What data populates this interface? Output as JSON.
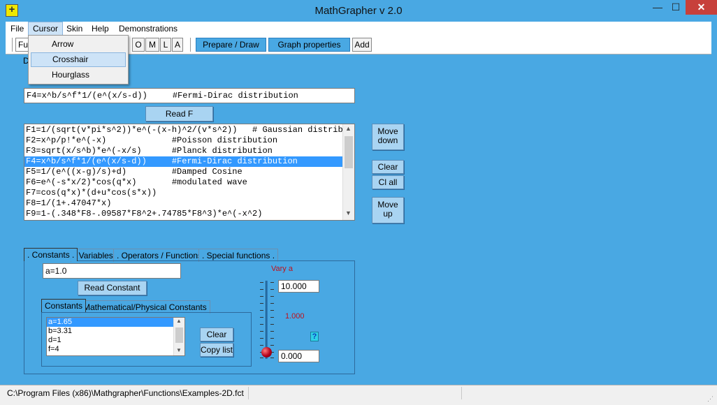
{
  "window": {
    "title": "MathGrapher v 2.0",
    "minimize": "—",
    "maximize": "☐",
    "close": "✕"
  },
  "menu": [
    "File",
    "Cursor",
    "Skin",
    "Help",
    "Demonstrations"
  ],
  "cursor_menu": [
    "Arrow",
    "Crosshair",
    "Hourglass"
  ],
  "toolbar": {
    "combo_value": "Fu",
    "letters": [
      "O",
      "M",
      "L",
      "A"
    ],
    "prepare_draw": "Prepare / Draw",
    "graph_properties": "Graph properties",
    "add": "Add"
  },
  "label_d": "D",
  "function_input": "F4=x^b/s^f*1/(e^(x/s-d))     #Fermi-Dirac distribution",
  "read_f": "Read F",
  "function_list": [
    "F1=1/(sqrt(v*pi*s^2))*e^(-(x-h)^2/(v*s^2))   # Gaussian distribut",
    "F2=x^p/p!*e^(-x)             #Poisson distribution",
    "F3=sqrt(x/s^b)*e^(-x/s)      #Planck distribution",
    "F4=x^b/s^f*1/(e^(x/s-d))     #Fermi-Dirac distribution",
    "F5=1/(e^((x-g)/s)+d)         #Damped Cosine",
    "F6=e^(-s*x/2)*cos(q*x)       #modulated wave",
    "F7=cos(q*x)*(d+u*cos(s*x))",
    "F8=1/(1+.47047*x)",
    "F9=1-(.348*F8-.09587*F8^2+.74785*F8^3)*e^(-x^2)"
  ],
  "side_buttons": {
    "move_down": "Move down",
    "clear": "Clear",
    "cl_all": "Cl all",
    "move_up": "Move up"
  },
  "tabs": [
    ". Constants .",
    ". Variables .",
    ". Operators / Functions .",
    ". Special functions ."
  ],
  "constant_input": "a=1.0",
  "read_constant": "Read Constant",
  "inner_tabs": [
    "Constants",
    "Mathematical/Physical Constants"
  ],
  "constants_list": [
    "a=1.65",
    "b=3.31",
    "d=1",
    "f=4"
  ],
  "clear_list": "Clear list",
  "copy_list": "Copy list",
  "vary": {
    "label": "Vary a",
    "max": "10.000",
    "current": "1.000",
    "min": "0.000",
    "help": "?",
    "slider_level": 0
  },
  "status": "C:\\Program Files (x86)\\Mathgrapher\\Functions\\Examples-2D.fct"
}
